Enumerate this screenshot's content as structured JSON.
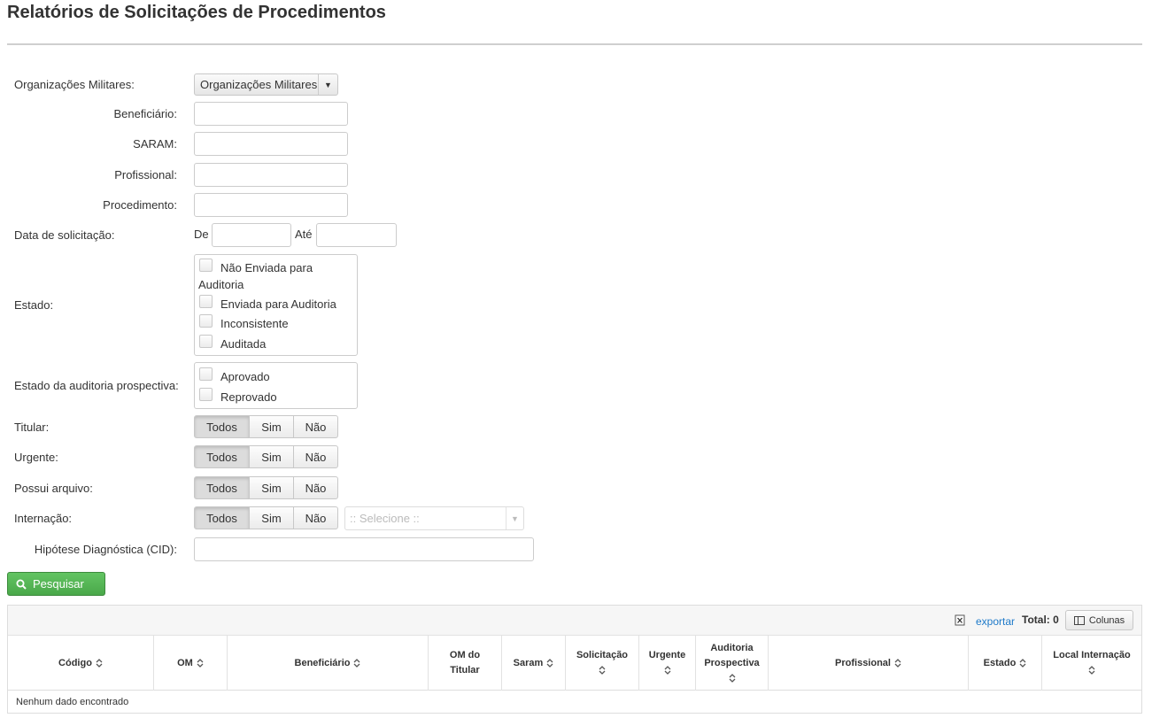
{
  "page": {
    "title": "Relatórios de Solicitações de Procedimentos"
  },
  "form": {
    "om": {
      "label": "Organizações Militares:",
      "value": "Organizações Militares"
    },
    "beneficiario": {
      "label": "Beneficiário:",
      "value": ""
    },
    "saram": {
      "label": "SARAM:",
      "value": ""
    },
    "profissional": {
      "label": "Profissional:",
      "value": ""
    },
    "procedimento": {
      "label": "Procedimento:",
      "value": ""
    },
    "data_solicitacao": {
      "label": "Data de solicitação:",
      "de_label": "De",
      "ate_label": "Até",
      "de_value": "",
      "ate_value": ""
    },
    "estado": {
      "label": "Estado:",
      "options": [
        {
          "line1": "Não Enviada para",
          "line2": "Auditoria",
          "checked": false
        },
        {
          "line1": "Enviada para Auditoria",
          "checked": false
        },
        {
          "line1": "Inconsistente",
          "checked": false
        },
        {
          "line1": "Auditada",
          "checked": false
        }
      ]
    },
    "estado_auditoria": {
      "label": "Estado da auditoria prospectiva:",
      "options": [
        {
          "line1": "Aprovado",
          "checked": false
        },
        {
          "line1": "Reprovado",
          "checked": false
        }
      ]
    },
    "titular": {
      "label": "Titular:",
      "options": [
        "Todos",
        "Sim",
        "Não"
      ],
      "selected": "Todos"
    },
    "urgente": {
      "label": "Urgente:",
      "options": [
        "Todos",
        "Sim",
        "Não"
      ],
      "selected": "Todos"
    },
    "possui_arquivo": {
      "label": "Possui arquivo:",
      "options": [
        "Todos",
        "Sim",
        "Não"
      ],
      "selected": "Todos"
    },
    "internacao": {
      "label": "Internação:",
      "options": [
        "Todos",
        "Sim",
        "Não"
      ],
      "selected": "Todos",
      "select_placeholder": ":: Selecione ::"
    },
    "cid": {
      "label": "Hipótese Diagnóstica (CID):",
      "value": ""
    },
    "search_button": "Pesquisar"
  },
  "table": {
    "export_label": "exportar",
    "total_label": "Total: 0",
    "columns_button": "Colunas",
    "columns": [
      {
        "line1": "Código",
        "line2": ""
      },
      {
        "line1": "OM",
        "line2": ""
      },
      {
        "line1": "Beneficiário",
        "line2": ""
      },
      {
        "line1": "OM do",
        "line2": "Titular"
      },
      {
        "line1": "Saram",
        "line2": ""
      },
      {
        "line1": "Solicitação",
        "line2": ""
      },
      {
        "line1": "Urgente",
        "line2": ""
      },
      {
        "line1": "Auditoria",
        "line2": "Prospectiva"
      },
      {
        "line1": "Profissional",
        "line2": ""
      },
      {
        "line1": "Estado",
        "line2": ""
      },
      {
        "line1": "Local Internação",
        "line2": ""
      }
    ],
    "empty_message": "Nenhum dado encontrado"
  },
  "colors": {
    "accent_green": "#5cb85c",
    "link_blue": "#1d79c9"
  }
}
